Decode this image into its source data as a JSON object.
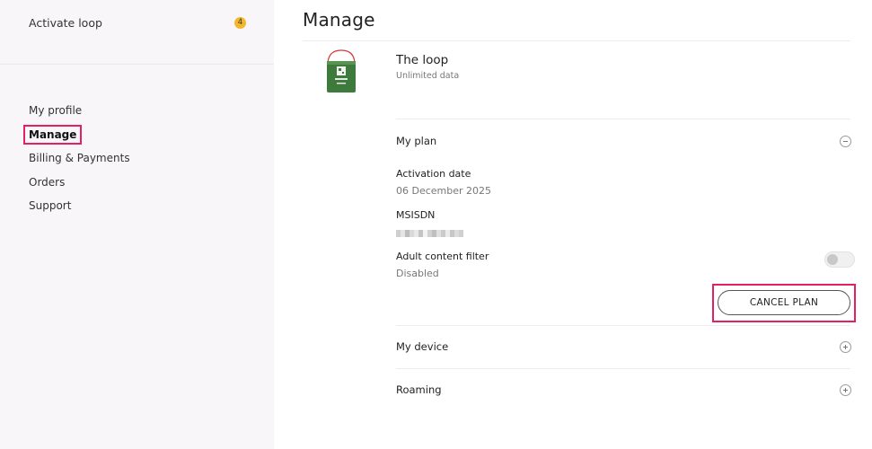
{
  "sidebar": {
    "activate": {
      "label": "Activate loop",
      "badge": "4"
    },
    "items": [
      {
        "label": "My profile",
        "active": false
      },
      {
        "label": "Manage",
        "active": true
      },
      {
        "label": "Billing & Payments",
        "active": false
      },
      {
        "label": "Orders",
        "active": false
      },
      {
        "label": "Support",
        "active": false
      }
    ]
  },
  "main": {
    "title": "Manage",
    "product": {
      "name": "The loop",
      "subtitle": "Unlimited data",
      "icon": "green-router-device"
    },
    "plan": {
      "title": "My plan",
      "expanded": true,
      "fields": {
        "activation_label": "Activation date",
        "activation_value": "06 December 2025",
        "msisdn_label": "MSISDN",
        "adult_label": "Adult content filter",
        "adult_value": "Disabled"
      },
      "adult_filter_on": false,
      "cancel_label": "CANCEL PLAN"
    },
    "device": {
      "title": "My device",
      "expanded": false
    },
    "roaming": {
      "title": "Roaming",
      "expanded": false
    }
  },
  "colors": {
    "highlight": "#e3215e",
    "badge": "#f5b72a",
    "sidebar_bg": "#f8f6f9",
    "device_green": "#3e7a3b"
  }
}
